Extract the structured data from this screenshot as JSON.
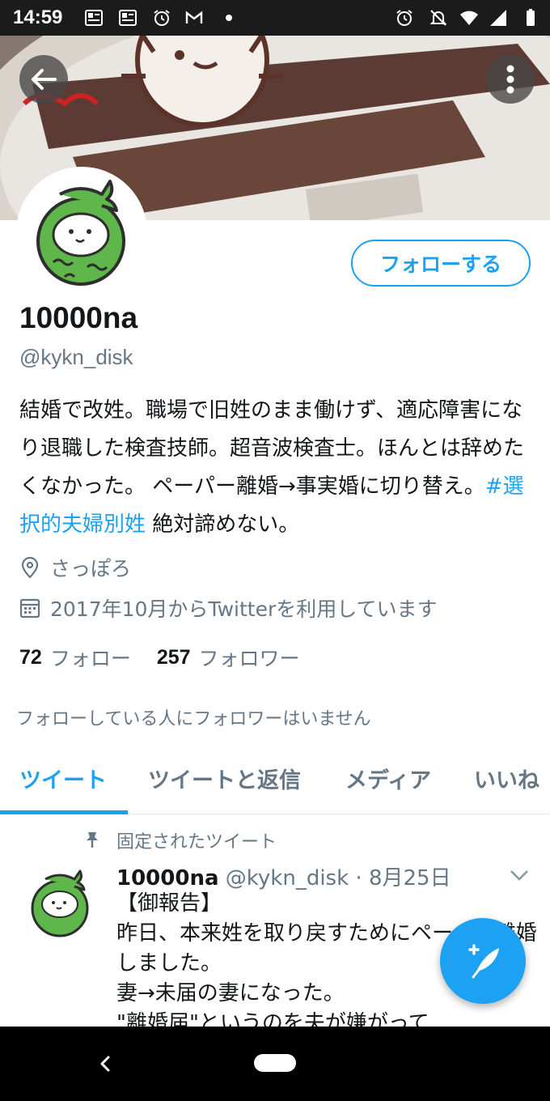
{
  "status_bar": {
    "time": "14:59",
    "icons": [
      "news-icon",
      "news-icon",
      "alarm-icon",
      "gmail-icon",
      "dot-icon",
      "alarm-icon",
      "bell-off-icon",
      "wifi-icon",
      "signal-icon",
      "battery-icon"
    ]
  },
  "header": {
    "back_icon": "arrow-left-icon",
    "more_icon": "more-vertical-icon"
  },
  "profile": {
    "follow_label": "フォローする",
    "display_name": "10000na",
    "handle": "@kykn_disk",
    "bio_text": "結婚で改姓。職場で旧姓のまま働けず、適応障害になり退職した検査技師。超音波検査士。ほんとは辞めたくなかった。 ペーパー離婚→事実婚に切り替え。",
    "bio_hashtag": "#選択的夫婦別姓",
    "bio_tail": " 絶対諦めない。",
    "location": "さっぽろ",
    "joined": "2017年10月からTwitterを利用しています",
    "following_count": "72",
    "following_label": "フォロー",
    "followers_count": "257",
    "followers_label": "フォロワー",
    "known_followers": "フォローしている人にフォロワーはいません"
  },
  "tabs": [
    {
      "label": "ツイート",
      "active": true
    },
    {
      "label": "ツイートと返信",
      "active": false
    },
    {
      "label": "メディア",
      "active": false
    },
    {
      "label": "いいね",
      "active": false
    }
  ],
  "pinned_tweet": {
    "pinned_label": "固定されたツイート",
    "name": "10000na",
    "meta": " @kykn_disk · 8月25日",
    "body": "【御報告】\n昨日、本来姓を取り戻すためにペーパー離婚しました。\n妻→未届の妻になった。\n\"離婚届\"というのを夫が嫌がって"
  },
  "colors": {
    "accent": "#1da1f2",
    "secondary_text": "#657786",
    "primary_text": "#14171a"
  }
}
